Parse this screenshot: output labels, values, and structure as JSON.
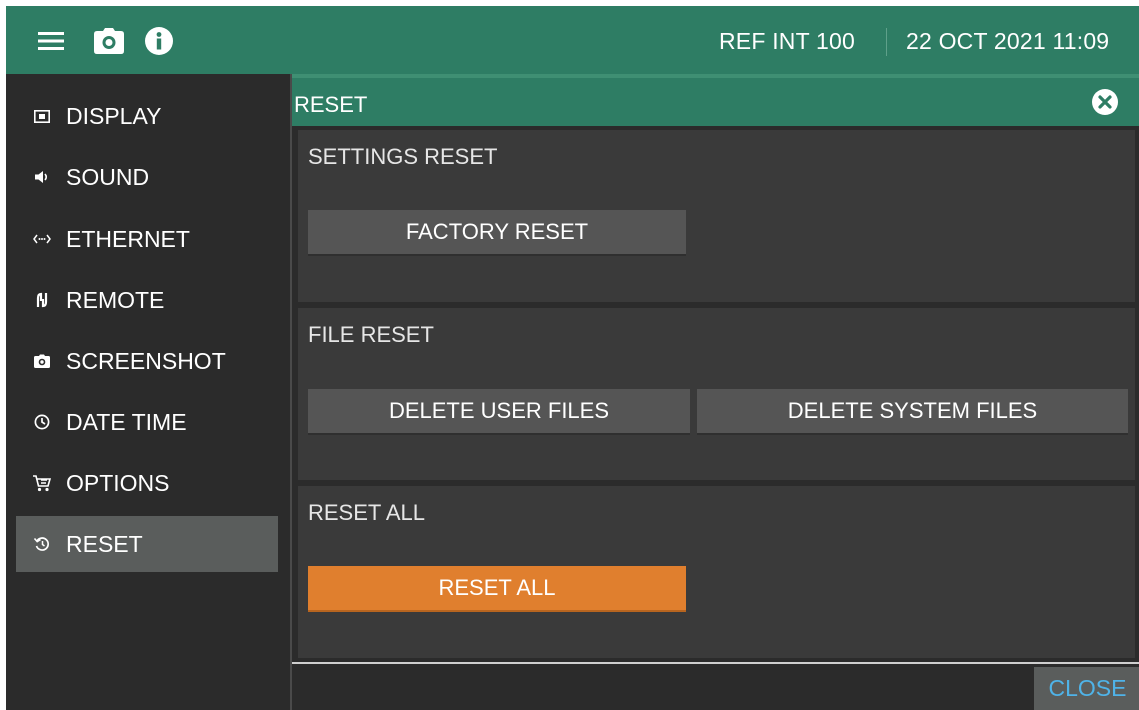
{
  "topbar": {
    "menu_icon": "hamburger-menu-icon",
    "camera_icon": "camera-icon",
    "info_icon": "info-icon",
    "reference": "REF INT 100",
    "datetime": "22 OCT 2021 11:09"
  },
  "sidebar": {
    "items": [
      {
        "label": "DISPLAY",
        "icon": "display-icon"
      },
      {
        "label": "SOUND",
        "icon": "speaker-icon"
      },
      {
        "label": "ETHERNET",
        "icon": "ethernet-icon"
      },
      {
        "label": "REMOTE",
        "icon": "remote-icon"
      },
      {
        "label": "SCREENSHOT",
        "icon": "camera-icon"
      },
      {
        "label": "DATE TIME",
        "icon": "clock-icon"
      },
      {
        "label": "OPTIONS",
        "icon": "cart-icon"
      },
      {
        "label": "RESET",
        "icon": "reset-icon",
        "active": true
      }
    ]
  },
  "panel": {
    "title": "RESET",
    "settings_reset": {
      "title": "SETTINGS RESET",
      "factory_reset_label": "FACTORY RESET"
    },
    "file_reset": {
      "title": "FILE RESET",
      "delete_user_label": "DELETE USER FILES",
      "delete_system_label": "DELETE SYSTEM FILES"
    },
    "reset_all": {
      "title": "RESET ALL",
      "button_label": "RESET ALL"
    },
    "close_label": "CLOSE"
  },
  "colors": {
    "header_green": "#2e7d64",
    "background": "#2b2b2b",
    "section": "#3a3a3a",
    "button": "#555555",
    "accent_orange": "#e07f2e",
    "close_text": "#4fb3e8",
    "active_item": "#5a5d5c"
  }
}
